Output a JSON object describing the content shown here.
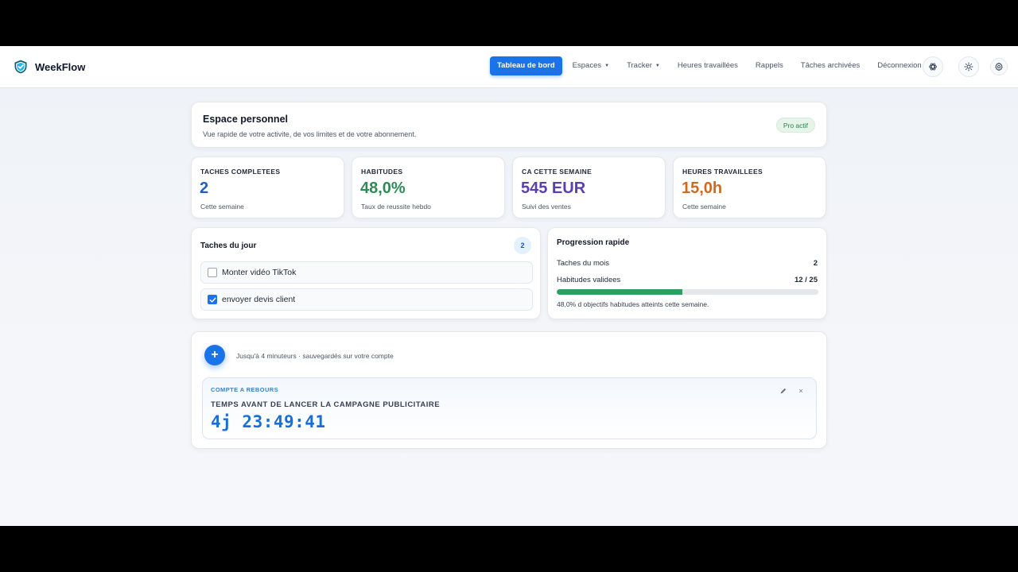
{
  "app": {
    "name": "WeekFlow"
  },
  "nav": {
    "items": [
      {
        "label": "Tableau de bord",
        "active": true,
        "dropdown": false
      },
      {
        "label": "Espaces",
        "active": false,
        "dropdown": true
      },
      {
        "label": "Tracker",
        "active": false,
        "dropdown": true
      },
      {
        "label": "Heures travaillées",
        "active": false,
        "dropdown": false
      },
      {
        "label": "Rappels",
        "active": false,
        "dropdown": false
      },
      {
        "label": "Tâches archivées",
        "active": false,
        "dropdown": false
      },
      {
        "label": "Déconnexion",
        "active": false,
        "dropdown": false
      }
    ],
    "icons": [
      "openai-icon",
      "sun-icon",
      "gear-icon"
    ]
  },
  "header": {
    "title": "Espace personnel",
    "subtitle": "Vue rapide de votre activite, de vos limites et de votre abonnement.",
    "badge": "Pro actif"
  },
  "stats": [
    {
      "label": "TACHES COMPLETEES",
      "value": "2",
      "sub": "Cette semaine",
      "color": "#1f5fbf"
    },
    {
      "label": "HABITUDES",
      "value": "48,0%",
      "sub": "Taux de reussite hebdo",
      "color": "#2e8b57"
    },
    {
      "label": "CA CETTE SEMAINE",
      "value": "545 EUR",
      "sub": "Suivi des ventes",
      "color": "#5b3fb0"
    },
    {
      "label": "HEURES TRAVAILLEES",
      "value": "15,0h",
      "sub": "Cette semaine",
      "color": "#d2691e"
    }
  ],
  "tasks": {
    "title": "Taches du jour",
    "count": "2",
    "items": [
      {
        "text": "Monter vidéo TikTok",
        "checked": false
      },
      {
        "text": "envoyer devis client",
        "checked": true
      }
    ]
  },
  "progress": {
    "title": "Progression rapide",
    "rows": [
      {
        "label": "Taches du mois",
        "value": "2"
      },
      {
        "label": "Habitudes validees",
        "value": "12 / 25"
      }
    ],
    "fraction": 0.48,
    "note": "48,0% d objectifs habitudes atteints cette semaine."
  },
  "timers": {
    "hint": "Jusqu'à 4 minuteurs · sauvegardés sur votre compte",
    "add_label": "+",
    "countdown": {
      "kicker": "COMPTE A REBOURS",
      "title": "TEMPS AVANT DE LANCER LA CAMPAGNE PUBLICITAIRE",
      "time": "4j 23:49:41",
      "close": "×"
    }
  },
  "colors": {
    "primary": "#1a73e8",
    "success": "#2f9e63"
  }
}
